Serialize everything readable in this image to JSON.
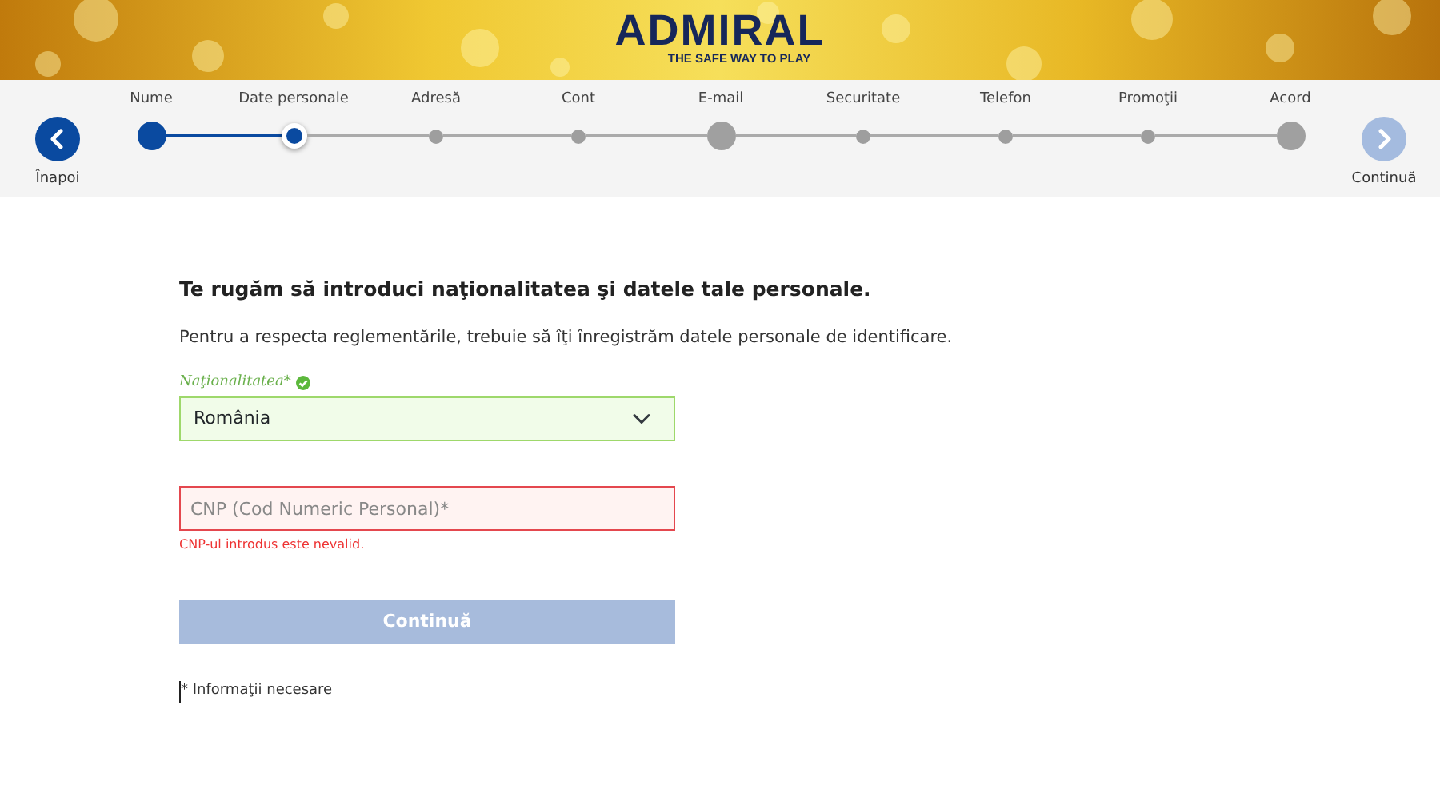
{
  "header": {
    "kind": "picture",
    "logo": "ADMIRAL",
    "tagline": "THE SAFE WAY TO PLAY"
  },
  "nav": {
    "back": "Înapoi",
    "next": "Continuă",
    "next_disabled": true
  },
  "steps": [
    {
      "label": "Nume",
      "done": true,
      "selected": false,
      "major": true
    },
    {
      "label": "Date personale",
      "done": false,
      "selected": true,
      "major": false
    },
    {
      "label": "Adresă",
      "done": false,
      "selected": false,
      "major": false
    },
    {
      "label": "Cont",
      "done": false,
      "selected": false,
      "major": false
    },
    {
      "label": "E-mail",
      "done": false,
      "selected": false,
      "major": true
    },
    {
      "label": "Securitate",
      "done": false,
      "selected": false,
      "major": false
    },
    {
      "label": "Telefon",
      "done": false,
      "selected": false,
      "major": false
    },
    {
      "label": "Promoţii",
      "done": false,
      "selected": false,
      "major": false
    },
    {
      "label": "Acord",
      "done": false,
      "selected": false,
      "major": true
    }
  ],
  "form": {
    "heading": "Te rugăm să introduci naţionalitatea şi datele tale personale.",
    "intro": "Pentru a respecta reglementările, trebuie să îţi înregistrăm datele personale de identificare.",
    "nationality": {
      "label": "Naţionalitatea*",
      "valid": true,
      "value": "România"
    },
    "cnp": {
      "placeholder": "CNP (Cod Numeric Personal)*",
      "invalid": true,
      "error": "CNP-ul introdus este nevalid."
    },
    "submit": {
      "label": "Continuă",
      "disabled": true
    },
    "note": "* Informaţii necesare"
  }
}
